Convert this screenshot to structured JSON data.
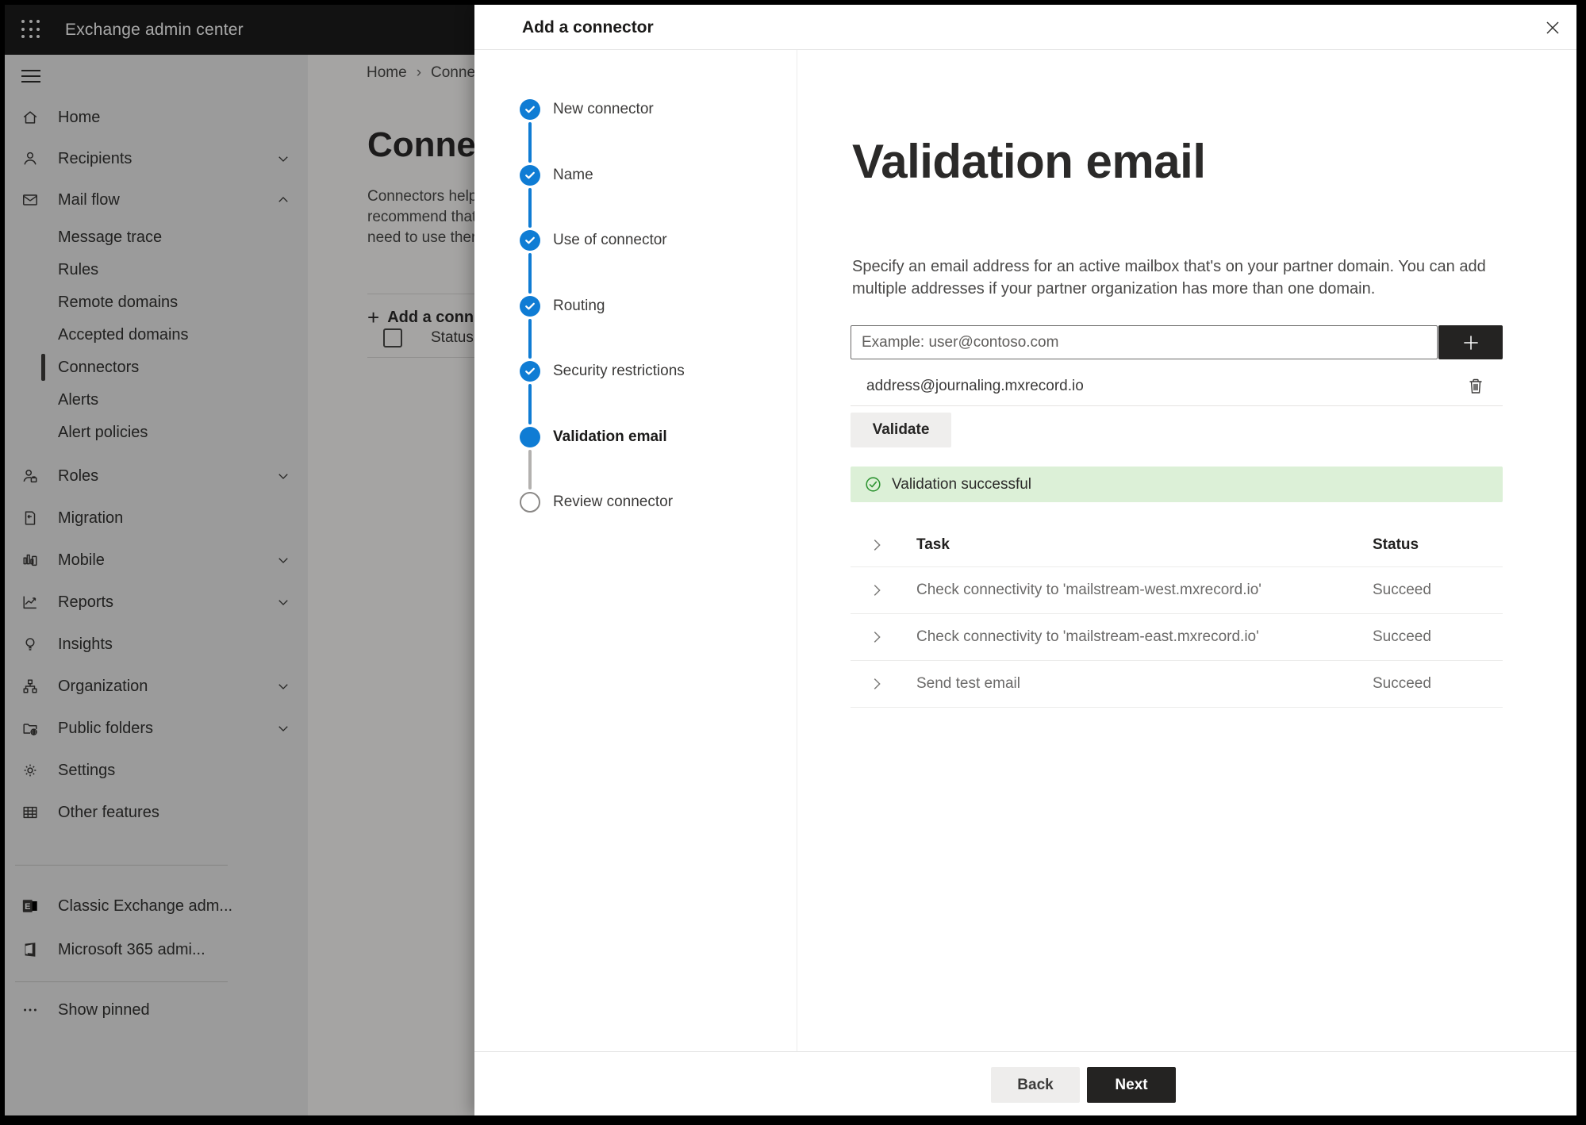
{
  "topbar": {
    "app_name": "Exchange admin center"
  },
  "breadcrumb": {
    "items": [
      "Home",
      "Conne"
    ]
  },
  "underlying_page": {
    "heading_fragment": "Connect",
    "paragraph_lines": [
      "Connectors help",
      "recommend that",
      "need to use ther"
    ],
    "add_button_fragment": "Add a conn",
    "status_column_fragment": "Status"
  },
  "sidebar": {
    "items": [
      {
        "label": "Home",
        "icon": "home-icon",
        "type": "top"
      },
      {
        "label": "Recipients",
        "icon": "person-icon",
        "type": "top",
        "chevron": "down"
      },
      {
        "label": "Mail flow",
        "icon": "mail-icon",
        "type": "top",
        "chevron": "up"
      },
      {
        "label": "Message trace",
        "type": "sub"
      },
      {
        "label": "Rules",
        "type": "sub"
      },
      {
        "label": "Remote domains",
        "type": "sub"
      },
      {
        "label": "Accepted domains",
        "type": "sub"
      },
      {
        "label": "Connectors",
        "type": "sub",
        "selected": true
      },
      {
        "label": "Alerts",
        "type": "sub"
      },
      {
        "label": "Alert policies",
        "type": "sub"
      },
      {
        "label": "Roles",
        "icon": "roles-icon",
        "type": "top",
        "chevron": "down"
      },
      {
        "label": "Migration",
        "icon": "migration-icon",
        "type": "top"
      },
      {
        "label": "Mobile",
        "icon": "mobile-icon",
        "type": "top",
        "chevron": "down"
      },
      {
        "label": "Reports",
        "icon": "reports-icon",
        "type": "top",
        "chevron": "down"
      },
      {
        "label": "Insights",
        "icon": "insights-icon",
        "type": "top"
      },
      {
        "label": "Organization",
        "icon": "organization-icon",
        "type": "top",
        "chevron": "down"
      },
      {
        "label": "Public folders",
        "icon": "public-folders-icon",
        "type": "top",
        "chevron": "down"
      },
      {
        "label": "Settings",
        "icon": "settings-icon",
        "type": "top"
      },
      {
        "label": "Other features",
        "icon": "other-features-icon",
        "type": "top"
      },
      {
        "label": "Classic Exchange adm...",
        "icon": "classic-exchange-icon",
        "type": "link"
      },
      {
        "label": "Microsoft 365 admi...",
        "icon": "m365-icon",
        "type": "link"
      },
      {
        "label": "Show pinned",
        "icon": "ellipsis-icon",
        "type": "link"
      }
    ]
  },
  "panel": {
    "title": "Add a connector",
    "steps": [
      {
        "label": "New connector",
        "state": "done"
      },
      {
        "label": "Name",
        "state": "done"
      },
      {
        "label": "Use of connector",
        "state": "done"
      },
      {
        "label": "Routing",
        "state": "done"
      },
      {
        "label": "Security restrictions",
        "state": "done"
      },
      {
        "label": "Validation email",
        "state": "current"
      },
      {
        "label": "Review connector",
        "state": "todo"
      }
    ],
    "content": {
      "heading": "Validation email",
      "description_lines": [
        "Specify an email address for an active mailbox that's on your partner domain. You can add",
        "multiple addresses if your partner organization has more than one domain."
      ],
      "email_input": {
        "placeholder": "Example: user@contoso.com",
        "value": ""
      },
      "addresses": [
        {
          "email": "address@journaling.mxrecord.io"
        }
      ],
      "validate_button": "Validate",
      "banner": {
        "text": "Validation successful"
      },
      "tasks_table": {
        "columns": [
          "Task",
          "Status"
        ],
        "rows": [
          {
            "task": "Check connectivity to 'mailstream-west.mxrecord.io'",
            "status": "Succeed"
          },
          {
            "task": "Check connectivity to 'mailstream-east.mxrecord.io'",
            "status": "Succeed"
          },
          {
            "task": "Send test email",
            "status": "Succeed"
          }
        ]
      }
    },
    "footer": {
      "back": "Back",
      "next": "Next"
    }
  },
  "colors": {
    "accent_blue": "#0f7cd4",
    "success_green": "#2e9432",
    "banner_bg": "#dcf0d7",
    "topbar_bg": "#1c1c1c"
  }
}
